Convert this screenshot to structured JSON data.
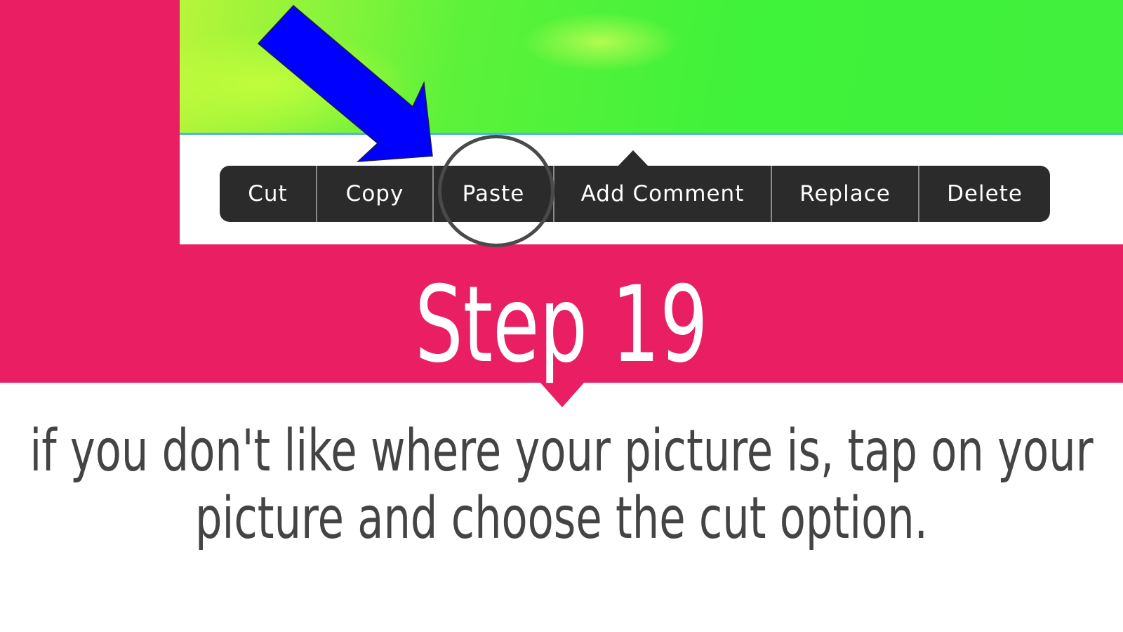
{
  "context_menu": {
    "items": [
      "Cut",
      "Copy",
      "Paste",
      "Add Comment",
      "Replace",
      "Delete"
    ],
    "highlighted": "Paste"
  },
  "step": {
    "title": "Step 19",
    "instruction": "if you don't like where your picture is, tap on your picture and choose the cut option."
  },
  "colors": {
    "band": "#e91e63",
    "menu_background": "#2b2b2b",
    "arrow": "#0000ff",
    "image_green": "#3ff23a",
    "instruction_text": "#444444"
  },
  "icons": {
    "pointer": "blue-arrow-icon",
    "highlight": "circle-highlight-icon"
  }
}
